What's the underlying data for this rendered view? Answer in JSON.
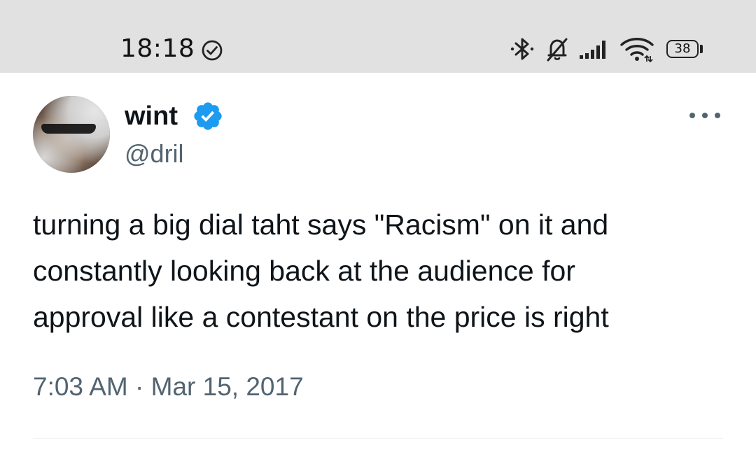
{
  "status_bar": {
    "time": "18:18",
    "battery_level": "38",
    "icons": [
      "check-circle-icon",
      "bluetooth-icon",
      "bell-off-icon",
      "signal-icon",
      "wifi-icon",
      "battery-icon"
    ]
  },
  "tweet": {
    "display_name": "wint",
    "handle": "@dril",
    "verified": true,
    "text": "turning a big dial taht says \"Racism\" on it and\nconstantly looking back at the audience for\napproval like a contestant on the price is right",
    "timestamp": "7:03 AM · Mar 15, 2017"
  },
  "colors": {
    "status_bar_bg": "#e1e1e1",
    "verified_blue": "#1d9bf0",
    "secondary_text": "#536471",
    "primary_text": "#0f1419"
  }
}
